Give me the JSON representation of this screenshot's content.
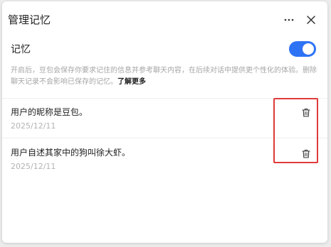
{
  "header": {
    "title": "管理记忆"
  },
  "memory_setting": {
    "label": "记忆",
    "enabled": true,
    "description": "开启后，豆包会保存你要求记住的信息并参考聊天内容，在后续对话中提供更个性化的体验。删除聊天记录不会影响已保存的记忆。",
    "learn_more": "了解更多"
  },
  "memories": [
    {
      "text": "用户的昵称是豆包。",
      "date": "2025/12/11"
    },
    {
      "text": "用户自述其家中的狗叫徐大虾。",
      "date": "2025/12/11"
    }
  ],
  "colors": {
    "accent": "#2f73f5",
    "highlight_border": "#e03a3a"
  },
  "icons": {
    "more": "more-horizontal-icon",
    "close": "close-icon",
    "trash": "trash-icon"
  }
}
